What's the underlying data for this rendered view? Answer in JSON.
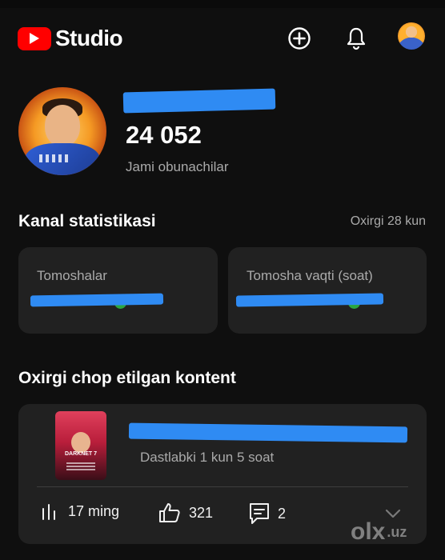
{
  "header": {
    "app_name": "Studio",
    "icons": [
      "youtube-logo-icon",
      "add-circle-icon",
      "bell-icon",
      "account-avatar-icon"
    ]
  },
  "channel": {
    "subscribers_count": "24 052",
    "subscribers_label": "Jami obunachilar"
  },
  "stats": {
    "title": "Kanal statistikasi",
    "period": "Oxirgi 28 kun",
    "cards": [
      {
        "label": "Tomoshalar"
      },
      {
        "label": "Tomosha vaqti (soat)"
      }
    ]
  },
  "latest": {
    "title": "Oxirgi chop etilgan kontent",
    "thumbnail_text": "DARKNET 7",
    "meta": "Dastlabki 1 kun 5 soat",
    "views": "17 ming",
    "likes": "321",
    "comments": "2"
  },
  "watermark": {
    "text": "olx",
    "suffix": ".uz"
  },
  "colors": {
    "background": "#0f0f0f",
    "card": "#212121",
    "youtube_red": "#ff0000",
    "redaction_blue": "#2f8bf3",
    "positive_green": "#2ba640"
  }
}
